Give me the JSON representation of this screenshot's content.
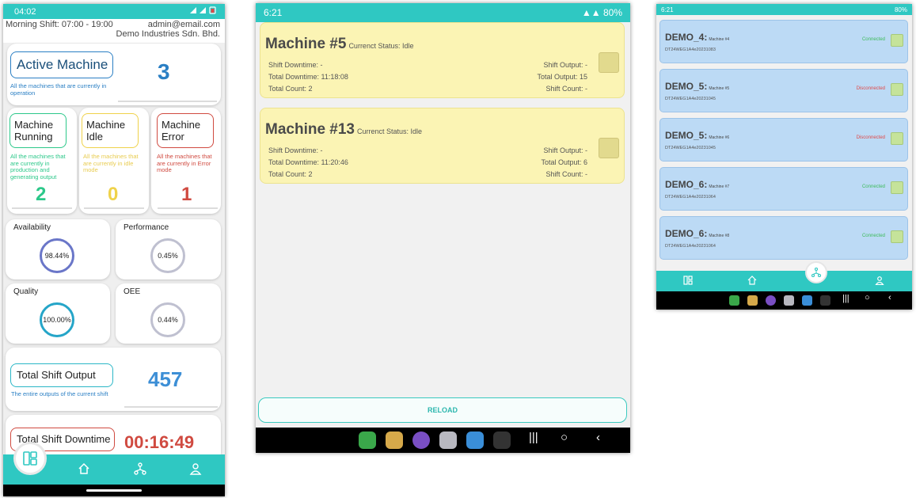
{
  "phone1": {
    "status_time": "04:02",
    "shift": "Morning Shift: 07:00 - 19:00",
    "email": "admin@email.com",
    "company": "Demo Industries Sdn. Bhd.",
    "active": {
      "label": "Active Machine",
      "desc": "All the machines that are currently in operation",
      "value": "3"
    },
    "running": {
      "label": "Machine Running",
      "desc": "All the machines that are currently in production and generating output",
      "value": "2"
    },
    "idle": {
      "label": "Machine Idle",
      "desc": "All the machines that are currently in idle mode",
      "value": "0"
    },
    "error": {
      "label": "Machine Error",
      "desc": "All the machines that are currently in Error mode",
      "value": "1"
    },
    "availability": {
      "label": "Availability",
      "value": "98.44%"
    },
    "performance": {
      "label": "Performance",
      "value": "0.45%"
    },
    "quality": {
      "label": "Quality",
      "value": "100.00%"
    },
    "oee": {
      "label": "OEE",
      "value": "0.44%"
    },
    "shift_output": {
      "label": "Total Shift Output",
      "desc": "The entire outputs of the current shift",
      "value": "457"
    },
    "shift_downtime": {
      "label": "Total Shift Downtime",
      "value": "00:16:49"
    }
  },
  "phone2": {
    "status_time": "6:21",
    "battery": "80%",
    "machines": [
      {
        "name": "Machine #5",
        "status": "Currenct Status: Idle",
        "shift_downtime": "Shift Downtime: -",
        "total_downtime": "Total Downtime: 11:18:08",
        "total_count": "Total Count: 2",
        "shift_output": "Shift Output: -",
        "total_output": "Total Output: 15",
        "shift_count": "Shift Count: -"
      },
      {
        "name": "Machine #13",
        "status": "Currenct Status: Idle",
        "shift_downtime": "Shift Downtime: -",
        "total_downtime": "Total Downtime: 11:20:46",
        "total_count": "Total Count: 2",
        "shift_output": "Shift Output: -",
        "total_output": "Total Output: 6",
        "shift_count": "Shift Count: -"
      }
    ],
    "reload": "RELOAD"
  },
  "phone3": {
    "status_time": "6:21",
    "battery": "80%",
    "devices": [
      {
        "name": "DEMO_4:",
        "machine": "Machine #4",
        "code": "DT24WEG1A4e20231083",
        "status": "Connected"
      },
      {
        "name": "DEMO_5:",
        "machine": "Machine #5",
        "code": "DT24WEG1A4e20231045",
        "status": "Disconnected"
      },
      {
        "name": "DEMO_5:",
        "machine": "Machine #6",
        "code": "DT24WEG1A4e20231045",
        "status": "Disconnected"
      },
      {
        "name": "DEMO_6:",
        "machine": "Machine #7",
        "code": "DT24WEG1A4e20231064",
        "status": "Connected"
      },
      {
        "name": "DEMO_6:",
        "machine": "Machine #8",
        "code": "DT24WEG1A4e20231064",
        "status": "Connected"
      }
    ]
  },
  "colors": {
    "teal": "#2fc8c2",
    "blue": "#2a7fc4",
    "green": "#2cc88a",
    "yellow": "#efd24a",
    "red": "#d04a40",
    "connected": "#3dbb5a",
    "disconnected": "#e04848"
  },
  "icons": [
    "dashboard-icon",
    "home-icon",
    "network-icon",
    "user-icon",
    "alarm-icon",
    "wifi-icon",
    "signal-icon",
    "battery-icon"
  ]
}
